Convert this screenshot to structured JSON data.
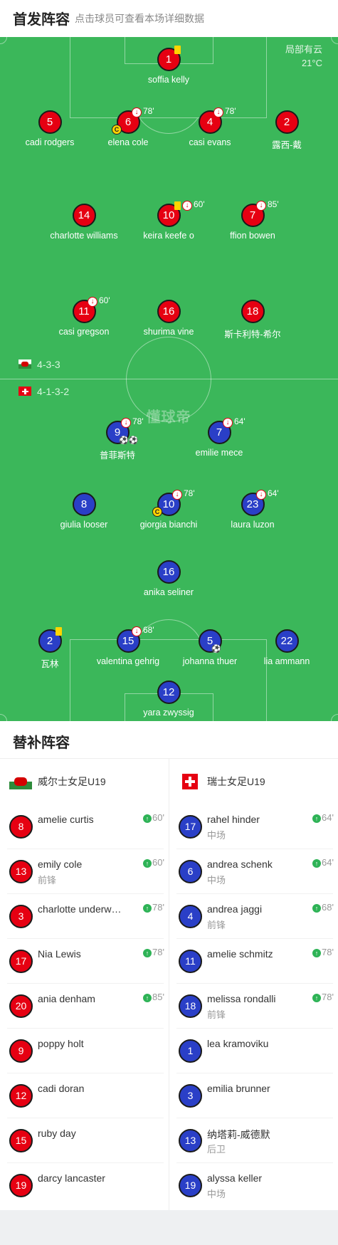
{
  "header": {
    "title": "首发阵容",
    "subtitle": "点击球员可查看本场详细数据"
  },
  "weather": {
    "condition": "局部有云",
    "temp": "21°C"
  },
  "watermark": "懂球帝",
  "home": {
    "formation": "4-3-3",
    "players": [
      {
        "num": "1",
        "name": "soffia kelly",
        "yellow": true
      },
      {
        "num": "5",
        "name": "cadi rodgers"
      },
      {
        "num": "6",
        "name": "elena cole",
        "sub": "78'",
        "captain": true
      },
      {
        "num": "4",
        "name": "casi evans",
        "sub": "78'"
      },
      {
        "num": "2",
        "name": "露西-戴"
      },
      {
        "num": "14",
        "name": "charlotte williams"
      },
      {
        "num": "10",
        "name": "keira keefe o",
        "sub": "60'",
        "yellow": true
      },
      {
        "num": "7",
        "name": "ffion bowen",
        "sub": "85'"
      },
      {
        "num": "11",
        "name": "casi gregson",
        "sub": "60'"
      },
      {
        "num": "16",
        "name": "shurima vine"
      },
      {
        "num": "18",
        "name": "斯卡利特-希尔"
      }
    ]
  },
  "away": {
    "formation": "4-1-3-2",
    "players": [
      {
        "num": "9",
        "name": "普菲斯特",
        "sub": "78'",
        "goals": "⚽⚽"
      },
      {
        "num": "7",
        "name": "emilie mece",
        "sub": "64'"
      },
      {
        "num": "8",
        "name": "giulia looser"
      },
      {
        "num": "10",
        "name": "giorgia bianchi",
        "sub": "78'",
        "captain": true
      },
      {
        "num": "23",
        "name": "laura luzon",
        "sub": "64'"
      },
      {
        "num": "16",
        "name": "anika seliner"
      },
      {
        "num": "2",
        "name": "瓦林",
        "yellow": true
      },
      {
        "num": "15",
        "name": "valentina gehrig",
        "sub": "68'"
      },
      {
        "num": "5",
        "name": "johanna thuer",
        "goals": "⚽"
      },
      {
        "num": "22",
        "name": "lia ammann"
      },
      {
        "num": "12",
        "name": "yara zwyssig"
      }
    ]
  },
  "subs": {
    "title": "替补阵容",
    "home_team": "威尔士女足U19",
    "away_team": "瑞士女足U19",
    "captain_mark": "C",
    "sub_arrow": "↓",
    "in_arrow": "↑",
    "home": [
      {
        "num": "8",
        "name": "amelie curtis",
        "pos": "",
        "in": "60'"
      },
      {
        "num": "13",
        "name": "emily cole",
        "pos": "前锋",
        "in": "60'"
      },
      {
        "num": "3",
        "name": "charlotte underwood",
        "pos": "",
        "in": "78'"
      },
      {
        "num": "17",
        "name": "Nia Lewis",
        "pos": "",
        "in": "78'"
      },
      {
        "num": "20",
        "name": "ania denham",
        "pos": "",
        "in": "85'"
      },
      {
        "num": "9",
        "name": "poppy holt",
        "pos": "",
        "in": ""
      },
      {
        "num": "12",
        "name": "cadi doran",
        "pos": "",
        "in": ""
      },
      {
        "num": "15",
        "name": "ruby day",
        "pos": "",
        "in": ""
      },
      {
        "num": "19",
        "name": "darcy lancaster",
        "pos": "",
        "in": ""
      }
    ],
    "away": [
      {
        "num": "17",
        "name": "rahel hinder",
        "pos": "中场",
        "in": "64'"
      },
      {
        "num": "6",
        "name": "andrea schenk",
        "pos": "中场",
        "in": "64'"
      },
      {
        "num": "4",
        "name": "andrea jaggi",
        "pos": "前锋",
        "in": "68'"
      },
      {
        "num": "11",
        "name": "amelie schmitz",
        "pos": "",
        "in": "78'"
      },
      {
        "num": "18",
        "name": "melissa rondalli",
        "pos": "前锋",
        "in": "78'"
      },
      {
        "num": "1",
        "name": "lea kramoviku",
        "pos": "",
        "in": ""
      },
      {
        "num": "3",
        "name": "emilia brunner",
        "pos": "",
        "in": ""
      },
      {
        "num": "13",
        "name": "纳塔莉-威德默",
        "pos": "后卫",
        "in": ""
      },
      {
        "num": "19",
        "name": "alyssa keller",
        "pos": "中场",
        "in": ""
      }
    ]
  }
}
